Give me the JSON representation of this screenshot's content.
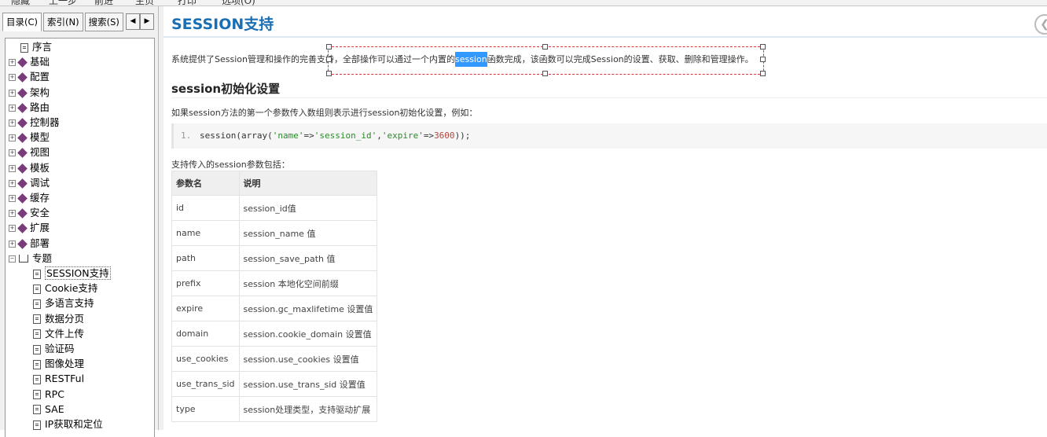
{
  "menubar": [
    "隐藏",
    "上一步",
    "前进",
    "主页",
    "打印",
    "选项(O)"
  ],
  "tabs": {
    "toc": "目录(C)",
    "index": "索引(N)",
    "search": "搜索(S)"
  },
  "scroll": {
    "left": "◀",
    "right": "▶"
  },
  "tree": [
    {
      "label": "序言",
      "type": "page",
      "level": 0
    },
    {
      "label": "基础",
      "type": "book",
      "level": 0
    },
    {
      "label": "配置",
      "type": "book",
      "level": 0
    },
    {
      "label": "架构",
      "type": "book",
      "level": 0
    },
    {
      "label": "路由",
      "type": "book",
      "level": 0
    },
    {
      "label": "控制器",
      "type": "book",
      "level": 0
    },
    {
      "label": "模型",
      "type": "book",
      "level": 0
    },
    {
      "label": "视图",
      "type": "book",
      "level": 0
    },
    {
      "label": "模板",
      "type": "book",
      "level": 0
    },
    {
      "label": "调试",
      "type": "book",
      "level": 0
    },
    {
      "label": "缓存",
      "type": "book",
      "level": 0
    },
    {
      "label": "安全",
      "type": "book",
      "level": 0
    },
    {
      "label": "扩展",
      "type": "book",
      "level": 0
    },
    {
      "label": "部署",
      "type": "book",
      "level": 0
    },
    {
      "label": "专题",
      "type": "open",
      "level": 0
    },
    {
      "label": "SESSION支持",
      "type": "page",
      "level": 1,
      "selected": true
    },
    {
      "label": "Cookie支持",
      "type": "page",
      "level": 1
    },
    {
      "label": "多语言支持",
      "type": "page",
      "level": 1
    },
    {
      "label": "数据分页",
      "type": "page",
      "level": 1
    },
    {
      "label": "文件上传",
      "type": "page",
      "level": 1
    },
    {
      "label": "验证码",
      "type": "page",
      "level": 1
    },
    {
      "label": "图像处理",
      "type": "page",
      "level": 1
    },
    {
      "label": "RESTFul",
      "type": "page",
      "level": 1
    },
    {
      "label": "RPC",
      "type": "page",
      "level": 1
    },
    {
      "label": "SAE",
      "type": "page",
      "level": 1
    },
    {
      "label": "IP获取和定位",
      "type": "page",
      "level": 1
    }
  ],
  "content": {
    "title": "SESSION支持",
    "intro_before": "系统提供了Session管理和操作的完善支持，全部操作可以通过一个内置的",
    "intro_highlight": "session",
    "intro_after": "函数完成，该函数可以完成Session的设置、获取、删除和管理操作。",
    "h2": "session初始化设置",
    "desc": "如果session方法的第一个参数传入数组则表示进行session初始化设置，例如：",
    "code_line_no": "1.",
    "code": {
      "fn": "session(array(",
      "k1": "'name'",
      "arrow1": "=>",
      "v1": "'session_id'",
      "comma": ",",
      "k2": "'expire'",
      "arrow2": "=>",
      "v2": "3600",
      "end": "));"
    },
    "params_intro": "支持传入的session参数包括：",
    "table": {
      "headers": [
        "参数名",
        "说明"
      ],
      "rows": [
        [
          "id",
          "session_id值"
        ],
        [
          "name",
          "session_name 值"
        ],
        [
          "path",
          "session_save_path 值"
        ],
        [
          "prefix",
          "session 本地化空间前缀"
        ],
        [
          "expire",
          "session.gc_maxlifetime 设置值"
        ],
        [
          "domain",
          "session.cookie_domain 设置值"
        ],
        [
          "use_cookies",
          "session.use_cookies 设置值"
        ],
        [
          "use_trans_sid",
          "session.use_trans_sid 设置值"
        ],
        [
          "type",
          "session处理类型，支持驱动扩展"
        ]
      ]
    }
  },
  "back_icon": "back-arrow-icon"
}
